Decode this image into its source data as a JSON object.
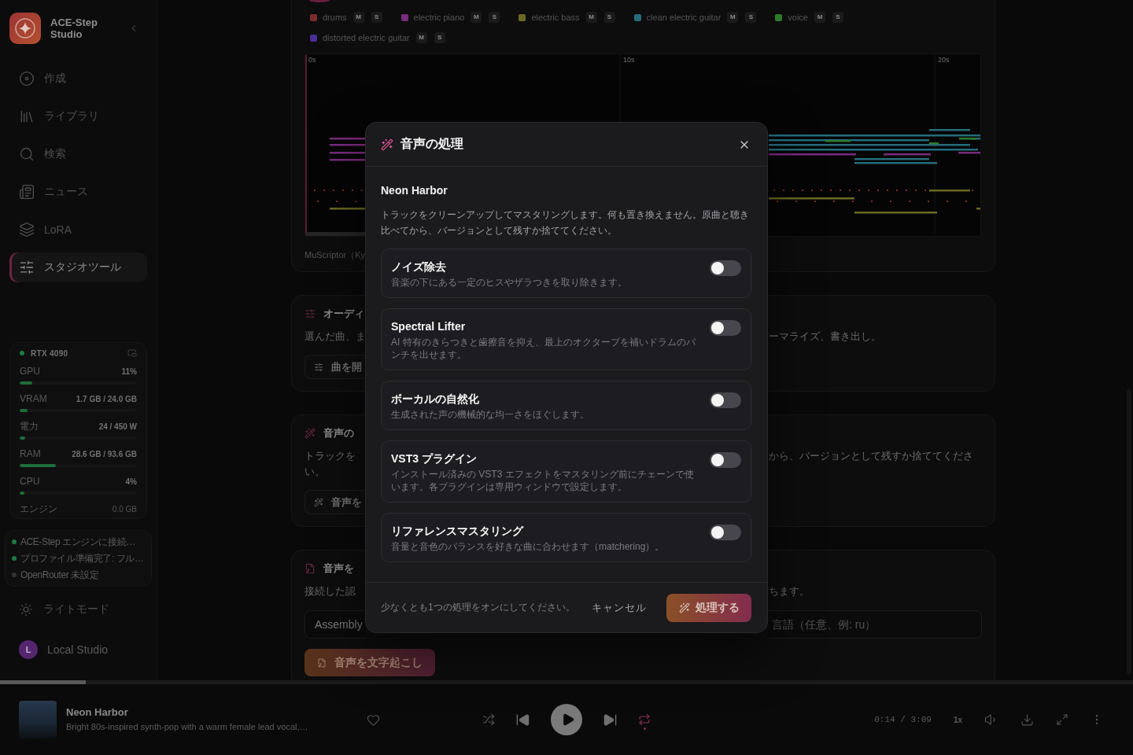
{
  "sidebar": {
    "brand": "ACE-Step Studio",
    "nav": [
      {
        "label": "作成",
        "selected": false
      },
      {
        "label": "ライブラリ",
        "selected": false
      },
      {
        "label": "検索",
        "selected": false
      },
      {
        "label": "ニュース",
        "selected": false
      },
      {
        "label": "LoRA",
        "selected": false
      },
      {
        "label": "スタジオツール",
        "selected": true
      }
    ],
    "hardware": {
      "device": "RTX 4090",
      "metrics": [
        {
          "kind": "meter",
          "label": "GPU",
          "reading": "11%",
          "level": 0.11
        },
        {
          "kind": "meter",
          "label": "VRAM",
          "reading": "1.7 GB / 24.0 GB",
          "level": 0.07
        },
        {
          "kind": "meter",
          "label": "電力",
          "reading": "24 / 450 W",
          "level": 0.05
        },
        {
          "kind": "meter",
          "label": "RAM",
          "reading": "28.6 GB / 93.6 GB",
          "level": 0.31
        },
        {
          "kind": "meter",
          "label": "CPU",
          "reading": "4%",
          "level": 0.04
        },
        {
          "kind": "plain",
          "label": "エンジン",
          "reading": "0.0 GB"
        }
      ]
    },
    "status": [
      {
        "text": "ACE-Step エンジンに接続…",
        "color": "#1f7a45"
      },
      {
        "text": "プロファイル準備完了: フル…",
        "color": "#1f7a45"
      },
      {
        "text": "OpenRouter 未設定",
        "color": "#333333"
      }
    ],
    "theme_toggle": "ライトモード",
    "user": {
      "initial": "L",
      "name": "Local Studio"
    }
  },
  "tracks_panel": {
    "tracks": [
      {
        "name": "drums",
        "color": "#7c2b2b",
        "mute": "M",
        "solo": "S",
        "muted": false,
        "soloed": false
      },
      {
        "name": "electric piano",
        "color": "#782a7c",
        "mute": "M",
        "solo": "S",
        "muted": false,
        "soloed": false
      },
      {
        "name": "electric bass",
        "color": "#6a6a24",
        "mute": "M",
        "solo": "S",
        "muted": false,
        "soloed": false
      },
      {
        "name": "clean electric guitar",
        "color": "#246c7a",
        "mute": "M",
        "solo": "S",
        "muted": false,
        "soloed": false
      },
      {
        "name": "voice",
        "color": "#2c7a2c",
        "mute": "M",
        "solo": "S",
        "muted": false,
        "soloed": false
      },
      {
        "name": "distorted electric guitar",
        "color": "#4a2e96",
        "mute": "M",
        "solo": "S",
        "muted": false,
        "soloed": false
      }
    ],
    "time_labels": [
      "0s",
      "10s",
      "20s"
    ],
    "caption": "MuScriptor（Ky"
  },
  "tool_cards": [
    {
      "title": "オーディ",
      "left_lines": [
        "選んだ曲、ま"
      ],
      "right_lines": [
        "ーマライズ、書き出し。"
      ],
      "button": {
        "kind": "outline",
        "label": "曲を開",
        "disabled": false
      }
    },
    {
      "title": "音声の",
      "left_lines": [
        "トラックを",
        "い。"
      ],
      "right_lines": [
        "から、バージョンとして残すか捨ててくださ"
      ],
      "button": {
        "kind": "outline",
        "label": "音声を",
        "disabled": false
      }
    },
    {
      "title": "音声を",
      "left_lines": [
        "接続した認"
      ],
      "right_lines": [
        "ちます。"
      ],
      "fields": [
        {
          "value": "Assembly"
        },
        {
          "placeholder": "言語（任意、例: ru）"
        }
      ],
      "button": {
        "kind": "primary",
        "label": "音声を文字起こし",
        "disabled": true
      }
    }
  ],
  "player": {
    "progress": {
      "level": 0.076
    },
    "title": "Neon Harbor",
    "subtitle": "Bright 80s-inspired synth-pop with a warm female lead vocal,…",
    "liked": false,
    "repeat": true,
    "time": "0:14 / 3:09",
    "speed": "1x"
  },
  "dialog": {
    "title": "音声の処理",
    "song": "Neon Harbor",
    "description": "トラックをクリーンアップしてマスタリングします。何も置き換えません。原曲と聴き比べてから、バージョンとして残すか捨ててください。",
    "options": [
      {
        "title": "ノイズ除去",
        "description": "音楽の下にある一定のヒスやザラつきを取り除きます。",
        "on": false
      },
      {
        "title": "Spectral Lifter",
        "description": "AI 特有のきらつきと歯擦音を抑え、最上のオクターブを補いドラムのパンチを出せます。",
        "on": false
      },
      {
        "title": "ボーカルの自然化",
        "description": "生成された声の機械的な均一さをほぐします。",
        "on": false
      },
      {
        "title": "VST3 プラグイン",
        "description": "インストール済みの VST3 エフェクトをマスタリング前にチェーンで使います。各プラグインは専用ウィンドウで設定します。",
        "on": false
      },
      {
        "title": "リファレンスマスタリング",
        "description": "音量と音色のバランスを好きな曲に合わせます（matchering）。",
        "on": false
      }
    ],
    "hint": "少なくとも1つの処理をオンにしてください。",
    "cancel": "キャンセル",
    "submit": {
      "label": "処理する",
      "disabled": true
    }
  }
}
